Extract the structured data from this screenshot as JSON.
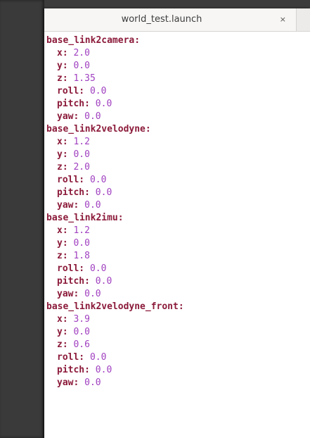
{
  "tab": {
    "title": "world_test.launch",
    "close_glyph": "×"
  },
  "editor": {
    "blocks": [
      {
        "name": "base_link2camera:",
        "fields": [
          {
            "key": "x:",
            "value": "2.0"
          },
          {
            "key": "y:",
            "value": "0.0"
          },
          {
            "key": "z:",
            "value": "1.35"
          },
          {
            "key": "roll:",
            "value": "0.0"
          },
          {
            "key": "pitch:",
            "value": "0.0"
          },
          {
            "key": "yaw:",
            "value": "0.0"
          }
        ]
      },
      {
        "name": "base_link2velodyne:",
        "fields": [
          {
            "key": "x:",
            "value": "1.2"
          },
          {
            "key": "y:",
            "value": "0.0"
          },
          {
            "key": "z:",
            "value": "2.0"
          },
          {
            "key": "roll:",
            "value": "0.0"
          },
          {
            "key": "pitch:",
            "value": "0.0"
          },
          {
            "key": "yaw:",
            "value": "0.0"
          }
        ]
      },
      {
        "name": "base_link2imu:",
        "fields": [
          {
            "key": "x:",
            "value": "1.2"
          },
          {
            "key": "y:",
            "value": "0.0"
          },
          {
            "key": "z:",
            "value": "1.8"
          },
          {
            "key": "roll:",
            "value": "0.0"
          },
          {
            "key": "pitch:",
            "value": "0.0"
          },
          {
            "key": "yaw:",
            "value": "0.0"
          }
        ]
      },
      {
        "name": "base_link2velodyne_front:",
        "fields": [
          {
            "key": "x:",
            "value": "3.9"
          },
          {
            "key": "y:",
            "value": "0.0"
          },
          {
            "key": "z:",
            "value": "0.6"
          },
          {
            "key": "roll:",
            "value": "0.0"
          },
          {
            "key": "pitch:",
            "value": "0.0"
          },
          {
            "key": "yaw:",
            "value": "0.0"
          }
        ]
      }
    ]
  },
  "colors": {
    "key": "#8b1a3a",
    "value": "#a040c0",
    "editor_background": "#ffffff",
    "tab_background": "#f7f6f5"
  }
}
